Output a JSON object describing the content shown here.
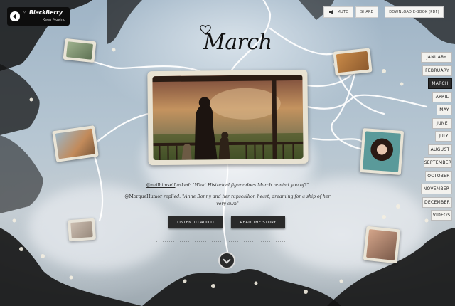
{
  "brand": {
    "name": "BlackBerry",
    "tagline": "Keep Moving"
  },
  "header": {
    "mute_label": "MUTE",
    "share_label": "SHARE",
    "download_label": "DOWNLOAD E-BOOK (PDF)"
  },
  "page": {
    "title": "March"
  },
  "story": {
    "question_handle": "@neilhimself",
    "question_text": " asked: \"What Historical figure does March remind you of?\"",
    "answer_handle": "@MorgueHumor",
    "answer_text": " replied: \"Anne Bonny and her rapscallion heart, dreaming for a ship of her very own\""
  },
  "actions": {
    "listen_label": "LISTEN TO AUDIO",
    "read_label": "READ THE STORY"
  },
  "months": [
    {
      "label": "JANUARY"
    },
    {
      "label": "FEBRUARY"
    },
    {
      "label": "MARCH",
      "active": true
    },
    {
      "label": "APRIL"
    },
    {
      "label": "MAY"
    },
    {
      "label": "JUNE"
    },
    {
      "label": "JULY"
    },
    {
      "label": "AUGUST"
    },
    {
      "label": "SEPTEMBER"
    },
    {
      "label": "OCTOBER"
    },
    {
      "label": "NOVEMBER"
    },
    {
      "label": "DECEMBER"
    },
    {
      "label": "VIDEOS"
    }
  ],
  "colors": {
    "sky": "#a9bccb",
    "active_month": "#2a2a2a",
    "button": "#2a2a2a"
  }
}
